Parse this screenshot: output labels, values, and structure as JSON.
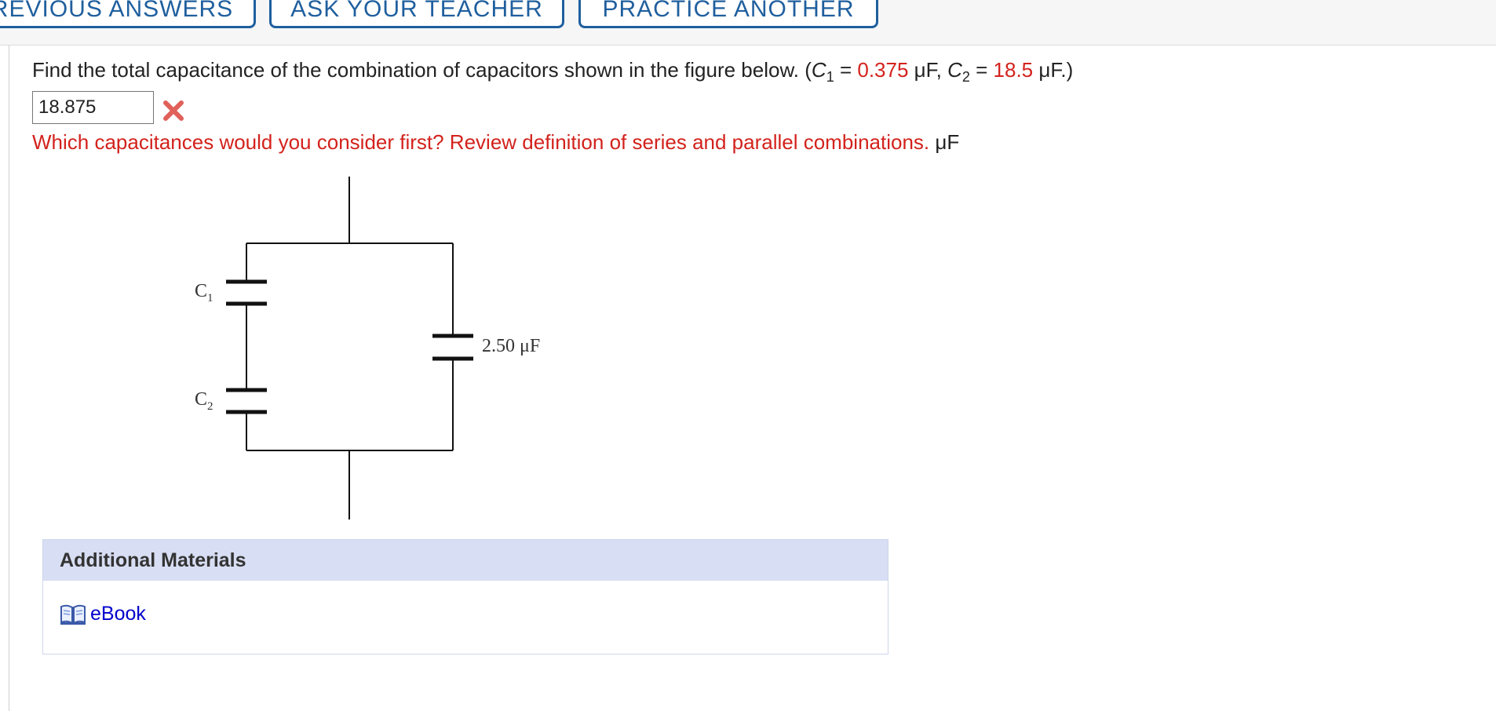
{
  "toolbar": {
    "previous_answers": "REVIOUS ANSWERS",
    "ask_teacher": "ASK YOUR TEACHER",
    "practice_another": "PRACTICE ANOTHER"
  },
  "question": {
    "text_before": "Find the total capacitance of the combination of capacitors shown in the figure below. (",
    "c1_symbol": "C",
    "c1_sub": "1",
    "eq": " = ",
    "c1_value": "0.375",
    "c1_unit": " μF, ",
    "c2_symbol": "C",
    "c2_sub": "2",
    "c2_value": "18.5",
    "c2_unit": " μF.)"
  },
  "answer": {
    "value": "18.875",
    "status": "incorrect",
    "status_icon": "x-mark-icon"
  },
  "feedback": {
    "message": "Which capacitances would you consider first? Review definition of series and parallel combinations.",
    "unit": " μF"
  },
  "figure": {
    "c1_label": "C",
    "c1_sub": "1",
    "c2_label": "C",
    "c2_sub": "2",
    "fixed_cap_label": "2.50 μF"
  },
  "additional_materials": {
    "title": "Additional Materials",
    "ebook_label": "eBook",
    "ebook_icon": "book-icon"
  },
  "colors": {
    "accent_blue": "#1f5f9e",
    "error_red": "#d3221c",
    "link_blue": "#0000cc",
    "panel_header": "#d8def3"
  }
}
